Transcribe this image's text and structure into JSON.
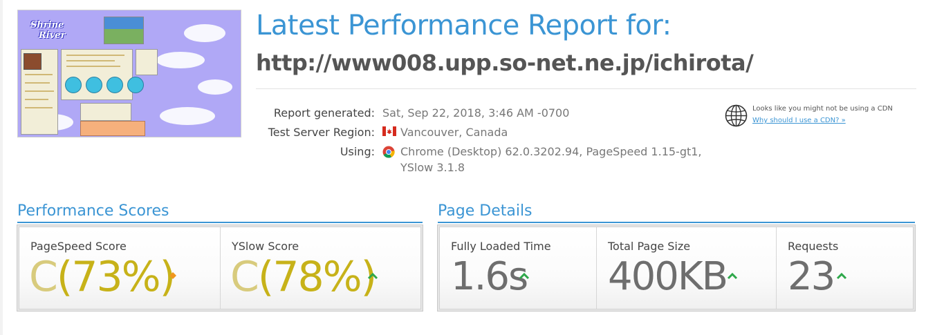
{
  "heading": {
    "title": "Latest Performance Report for:",
    "url": "http://www008.upp.so-net.ne.jp/ichirota/"
  },
  "thumbnail": {
    "site_title_line1": "Shrine",
    "site_title_line2": "River"
  },
  "meta": {
    "report_generated_label": "Report generated:",
    "report_generated_value": "Sat, Sep 22, 2018, 3:46 AM -0700",
    "region_label": "Test Server Region:",
    "region_value": "Vancouver, Canada",
    "using_label": "Using:",
    "using_value_line1": "Chrome (Desktop) 62.0.3202.94, PageSpeed 1.15-gt1,",
    "using_value_line2": "YSlow 3.1.8"
  },
  "cdn": {
    "icon": "globe-icon",
    "notice": "Looks like you might not be using a CDN",
    "link": "Why should I use a CDN? »"
  },
  "performance_scores": {
    "title": "Performance Scores",
    "pagespeed": {
      "label": "PageSpeed Score",
      "grade": "C",
      "percent": "(73%)",
      "indicator": "diamond"
    },
    "yslow": {
      "label": "YSlow Score",
      "grade": "C",
      "percent": "(78%)",
      "indicator": "up"
    }
  },
  "page_details": {
    "title": "Page Details",
    "load_time": {
      "label": "Fully Loaded Time",
      "value": "1.6s",
      "indicator": "up"
    },
    "page_size": {
      "label": "Total Page Size",
      "value": "400KB",
      "indicator": "up"
    },
    "requests": {
      "label": "Requests",
      "value": "23",
      "indicator": "up"
    }
  },
  "colors": {
    "accent_blue": "#3b95d4",
    "grade_c": "#c7b219",
    "indicator_green": "#2ea84a",
    "indicator_orange": "#f0961e"
  }
}
